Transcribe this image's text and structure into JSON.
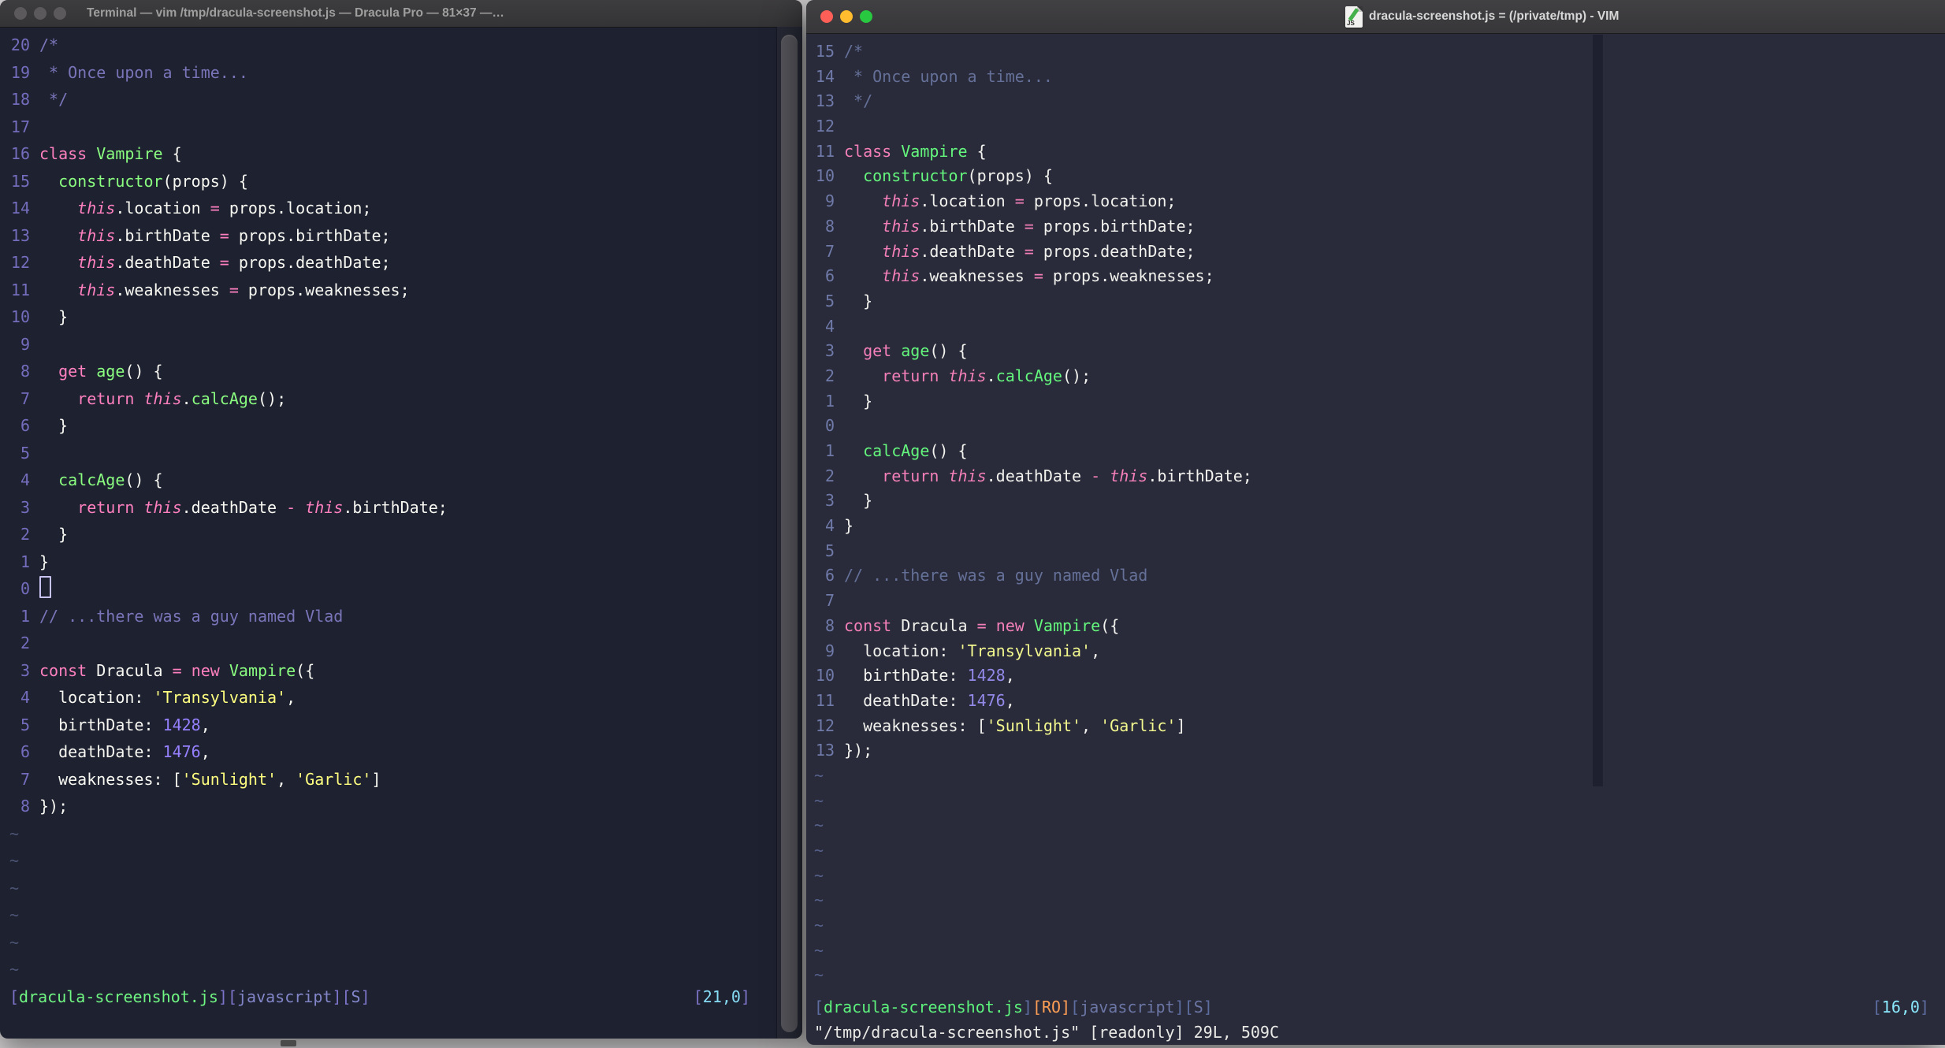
{
  "left_window": {
    "title": "Terminal — vim /tmp/dracula-screenshot.js — Dracula Pro — 81×37 —…",
    "traffic_lights": [
      "#5b595c",
      "#5b595c",
      "#5b595c"
    ],
    "numbers": [
      20,
      19,
      18,
      17,
      16,
      15,
      14,
      13,
      12,
      11,
      10,
      9,
      8,
      7,
      6,
      5,
      4,
      3,
      2,
      1,
      0,
      1,
      2,
      3,
      4,
      5,
      6,
      7,
      8
    ],
    "cursor_row": 20,
    "tilde": "~",
    "tilde_count": 6,
    "status_segments": [
      [
        "[",
        "br"
      ],
      [
        "dracula-screenshot.js",
        "sf"
      ],
      [
        "][",
        "br"
      ],
      [
        "javascript",
        "sk"
      ],
      [
        "][",
        "br"
      ],
      [
        "S",
        "sk"
      ],
      [
        "]",
        "br"
      ]
    ],
    "ruler_segments": [
      [
        "[",
        "br"
      ],
      [
        "21,0",
        "cy"
      ],
      [
        "]",
        "br"
      ]
    ],
    "palette": {
      "fg": "#f8f8f2",
      "pk": "#ff80bf",
      "gr": "#8aff80",
      "cm": "#7a74b9",
      "st": "#ffff80",
      "nm": "#9580ff",
      "th": "#ff80bf",
      "ti": "#4c5474",
      "ln": "#746dbd",
      "br": "#7d74c9",
      "sf": "#70f682",
      "sk": "#8286c9",
      "cy": "#86dcf5",
      "cur": "#c9c3f2"
    }
  },
  "right_window": {
    "title": "dracula-screenshot.js = (/private/tmp) - VIM",
    "icon_label": "JS",
    "traffic_lights": [
      "#ff5f57",
      "#febc2e",
      "#28c840"
    ],
    "numbers": [
      15,
      14,
      13,
      12,
      11,
      10,
      9,
      8,
      7,
      6,
      5,
      4,
      3,
      2,
      1,
      0,
      1,
      2,
      3,
      4,
      5,
      6,
      7,
      8,
      9,
      10,
      11,
      12,
      13
    ],
    "cursor_row": null,
    "tilde": "~",
    "tilde_count": 9,
    "status_segments": [
      [
        "[",
        "br"
      ],
      [
        "dracula-screenshot.js",
        "sf"
      ],
      [
        "]",
        "br"
      ],
      [
        "[RO]",
        "ro"
      ],
      [
        "[",
        "br"
      ],
      [
        "javascript",
        "sk"
      ],
      [
        "][",
        "br"
      ],
      [
        "S",
        "sk"
      ],
      [
        "]",
        "br"
      ]
    ],
    "ruler_segments": [
      [
        "[",
        "br"
      ],
      [
        "16,0",
        "cy"
      ],
      [
        "]",
        "br"
      ]
    ],
    "cmdline": "\"/tmp/dracula-screenshot.js\" [readonly] 29L, 509C",
    "palette": {
      "fg": "#f2f2ee",
      "pk": "#f47fb9",
      "gr": "#64f67d",
      "cm": "#657098",
      "st": "#f3f88e",
      "nm": "#9289e8",
      "th": "#f47fb9",
      "ti": "#56618c",
      "ln": "#6f7aa9",
      "br": "#5d6d9f",
      "sf": "#5df27c",
      "sk": "#6b76a5",
      "cy": "#8be9fd",
      "ro": "#ff9e55"
    }
  },
  "code": [
    [
      [
        "/*",
        "cm"
      ]
    ],
    [
      [
        " * Once upon a time...",
        "cm"
      ]
    ],
    [
      [
        " */",
        "cm"
      ]
    ],
    [],
    [
      [
        "class",
        "pk"
      ],
      [
        " ",
        "fg"
      ],
      [
        "Vampire",
        "gr"
      ],
      [
        " {",
        "fg"
      ]
    ],
    [
      [
        "  ",
        "fg"
      ],
      [
        "constructor",
        "gr"
      ],
      [
        "(props) {",
        "fg"
      ]
    ],
    [
      [
        "    ",
        "fg"
      ],
      [
        "this",
        "th"
      ],
      [
        ".location ",
        "fg"
      ],
      [
        "=",
        "pk"
      ],
      [
        " props.location;",
        "fg"
      ]
    ],
    [
      [
        "    ",
        "fg"
      ],
      [
        "this",
        "th"
      ],
      [
        ".birthDate ",
        "fg"
      ],
      [
        "=",
        "pk"
      ],
      [
        " props.birthDate;",
        "fg"
      ]
    ],
    [
      [
        "    ",
        "fg"
      ],
      [
        "this",
        "th"
      ],
      [
        ".deathDate ",
        "fg"
      ],
      [
        "=",
        "pk"
      ],
      [
        " props.deathDate;",
        "fg"
      ]
    ],
    [
      [
        "    ",
        "fg"
      ],
      [
        "this",
        "th"
      ],
      [
        ".weaknesses ",
        "fg"
      ],
      [
        "=",
        "pk"
      ],
      [
        " props.weaknesses;",
        "fg"
      ]
    ],
    [
      [
        "  }",
        "fg"
      ]
    ],
    [],
    [
      [
        "  ",
        "fg"
      ],
      [
        "get",
        "pk"
      ],
      [
        " ",
        "fg"
      ],
      [
        "age",
        "gr"
      ],
      [
        "() {",
        "fg"
      ]
    ],
    [
      [
        "    ",
        "fg"
      ],
      [
        "return",
        "pk"
      ],
      [
        " ",
        "fg"
      ],
      [
        "this",
        "th"
      ],
      [
        ".",
        "fg"
      ],
      [
        "calcAge",
        "gr"
      ],
      [
        "();",
        "fg"
      ]
    ],
    [
      [
        "  }",
        "fg"
      ]
    ],
    [],
    [
      [
        "  ",
        "fg"
      ],
      [
        "calcAge",
        "gr"
      ],
      [
        "() {",
        "fg"
      ]
    ],
    [
      [
        "    ",
        "fg"
      ],
      [
        "return",
        "pk"
      ],
      [
        " ",
        "fg"
      ],
      [
        "this",
        "th"
      ],
      [
        ".deathDate ",
        "fg"
      ],
      [
        "-",
        "pk"
      ],
      [
        " ",
        "fg"
      ],
      [
        "this",
        "th"
      ],
      [
        ".birthDate;",
        "fg"
      ]
    ],
    [
      [
        "  }",
        "fg"
      ]
    ],
    [
      [
        "}",
        "fg"
      ]
    ],
    [],
    [
      [
        "// ...there was a guy named Vlad",
        "cm"
      ]
    ],
    [],
    [
      [
        "const",
        "pk"
      ],
      [
        " Dracula ",
        "fg"
      ],
      [
        "=",
        "pk"
      ],
      [
        " ",
        "fg"
      ],
      [
        "new",
        "pk"
      ],
      [
        " ",
        "fg"
      ],
      [
        "Vampire",
        "gr"
      ],
      [
        "({",
        "fg"
      ]
    ],
    [
      [
        "  location: ",
        "fg"
      ],
      [
        "'Transylvania'",
        "st"
      ],
      [
        ",",
        "fg"
      ]
    ],
    [
      [
        "  birthDate: ",
        "fg"
      ],
      [
        "1428",
        "nm"
      ],
      [
        ",",
        "fg"
      ]
    ],
    [
      [
        "  deathDate: ",
        "fg"
      ],
      [
        "1476",
        "nm"
      ],
      [
        ",",
        "fg"
      ]
    ],
    [
      [
        "  weaknesses: [",
        "fg"
      ],
      [
        "'Sunlight'",
        "st"
      ],
      [
        ", ",
        "fg"
      ],
      [
        "'Garlic'",
        "st"
      ],
      [
        "]",
        "fg"
      ]
    ],
    [
      [
        "});",
        "fg"
      ]
    ]
  ]
}
